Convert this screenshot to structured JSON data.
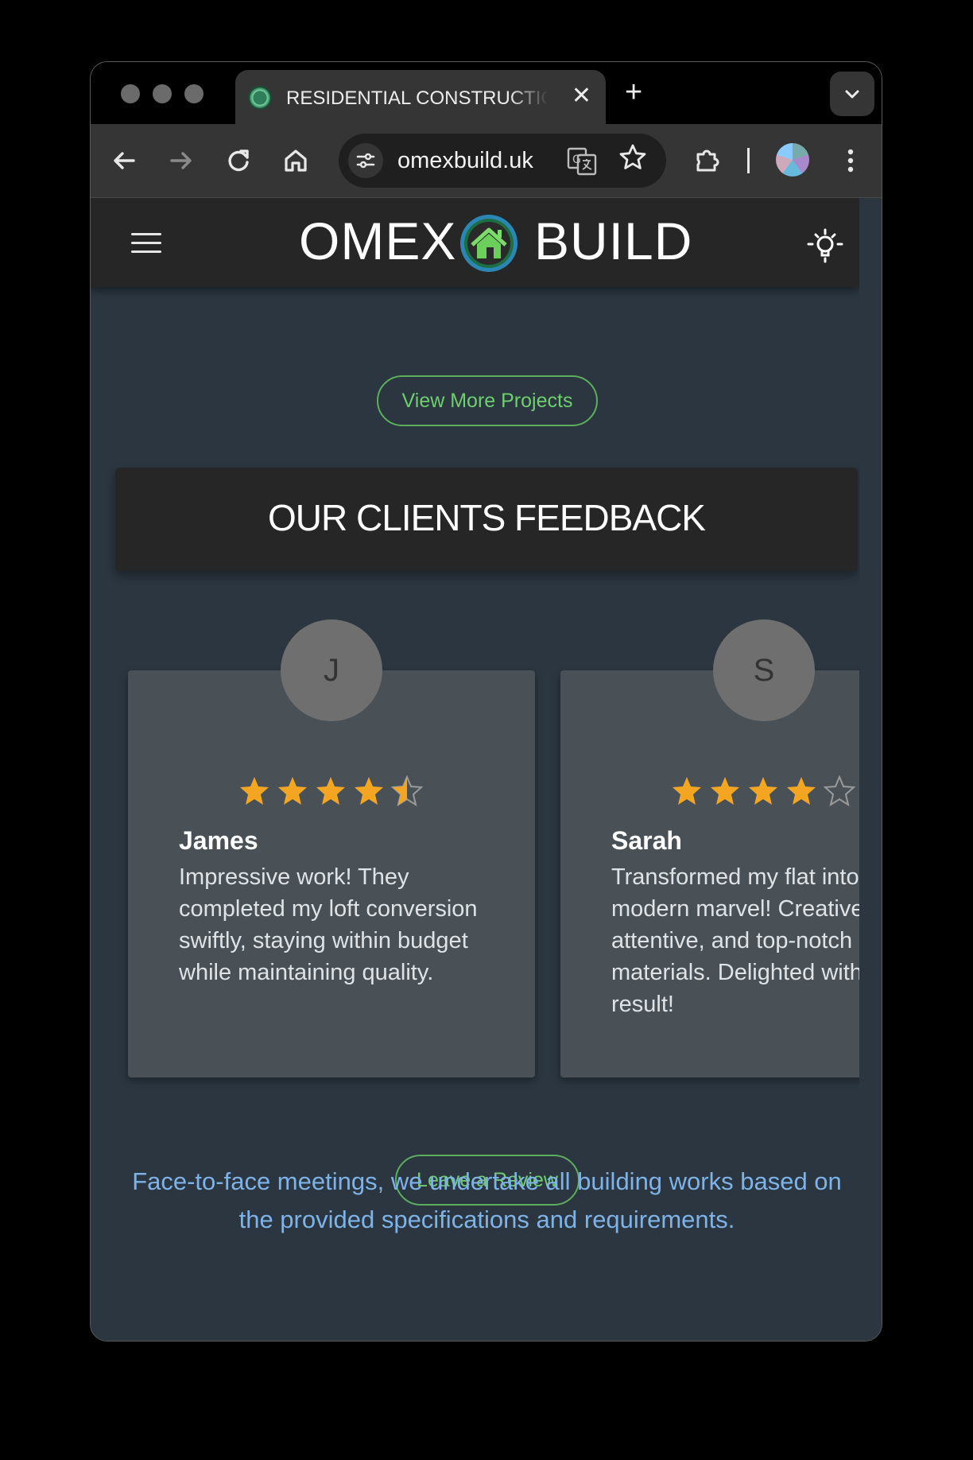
{
  "browser": {
    "tab_title": "RESIDENTIAL CONSTRUCTIO",
    "tab_close": "✕",
    "new_tab": "+",
    "url": "omexbuild.uk"
  },
  "site": {
    "logo_left": "OMEX",
    "logo_right": "BUILD",
    "view_more_label": "View More Projects",
    "feedback_title": "OUR CLIENTS FEEDBACK",
    "leave_review_label": "Leave a Review",
    "footer_text": "Face-to-face meetings, we undertake all building works based on the provided specifications and requirements."
  },
  "reviews": [
    {
      "initial": "J",
      "name": "James",
      "rating": 4.5,
      "text": "Impressive work! They completed my loft conversion swiftly, staying within budget while maintaining quality."
    },
    {
      "initial": "S",
      "name": "Sarah",
      "rating": 4,
      "text": "Transformed my flat into a modern marvel! Creative, attentive, and top-notch materials. Delighted with the result!"
    }
  ],
  "colors": {
    "page_bg": "#2b3640",
    "header_bg": "#262626",
    "card_bg": "#495157",
    "accent_green": "#5cae5c",
    "star_gold": "#f4a623",
    "link_blue": "#7db3e8"
  },
  "icons": {
    "back": "back-arrow-icon",
    "forward": "forward-arrow-icon",
    "reload": "reload-icon",
    "home": "home-icon",
    "bookmark": "star-icon",
    "extensions": "puzzle-icon",
    "menu": "hamburger-icon",
    "theme": "lightbulb-icon"
  }
}
